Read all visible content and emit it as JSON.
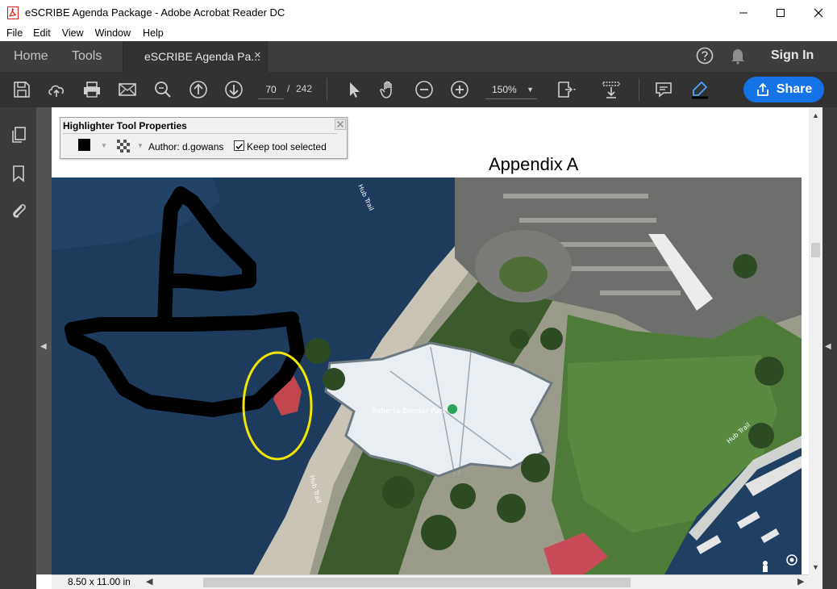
{
  "window": {
    "title": "eSCRIBE Agenda Package - Adobe Acrobat Reader DC"
  },
  "menu": [
    "File",
    "Edit",
    "View",
    "Window",
    "Help"
  ],
  "tabs": {
    "home": "Home",
    "tools": "Tools",
    "document": "eSCRIBE Agenda Pa...",
    "close": "×",
    "sign_in": "Sign In"
  },
  "toolbar": {
    "current_page": "70",
    "page_separator": "/",
    "total_pages": "242",
    "zoom": "150%",
    "share": "Share",
    "icons": [
      "save-icon",
      "upload-icon",
      "print-icon",
      "email-icon",
      "search-icon",
      "prev-page-icon",
      "next-page-icon",
      "select-cursor-icon",
      "hand-tool-icon",
      "zoom-out-icon",
      "zoom-in-icon",
      "page-fit-icon",
      "scroll-mode-icon",
      "comment-icon",
      "highlight-pen-icon"
    ]
  },
  "highlighter_panel": {
    "title": "Highlighter Tool Properties",
    "color": "#000000",
    "author": "Author:  d.gowans",
    "keep_tool": "Keep tool selected",
    "keep_tool_checked": true
  },
  "page": {
    "heading": "Appendix A",
    "map_label": "Roberta Bondar Park",
    "path_labels": [
      "Hub Trail",
      "Hub Trail",
      "Hub Trail"
    ]
  },
  "status": {
    "page_size": "8.50 x 11.00 in"
  },
  "colors": {
    "share_blue": "#1473e6",
    "highlight_yellow": "#f2e600",
    "annotation_black": "#000000"
  }
}
